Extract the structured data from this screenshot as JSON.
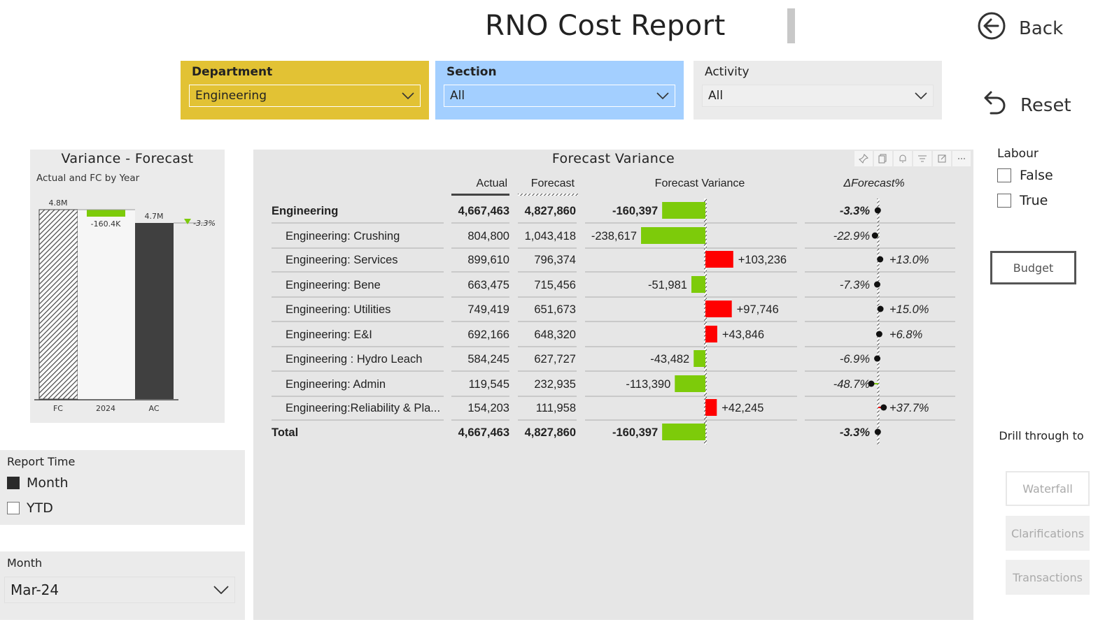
{
  "header": {
    "title": "RNO Cost Report",
    "back_label": "Back",
    "reset_label": "Reset"
  },
  "slicers": {
    "department": {
      "label": "Department",
      "value": "Engineering"
    },
    "section": {
      "label": "Section",
      "value": "All"
    },
    "activity": {
      "label": "Activity",
      "value": "All"
    }
  },
  "variance_chart": {
    "title": "Variance - Forecast",
    "subtitle": "Actual and FC by Year",
    "labels": {
      "fc": "4.8M",
      "delta": "-160.4K",
      "ac": "4.7M",
      "pct": "-3.3%"
    },
    "categories": [
      "FC",
      "2024",
      "AC"
    ]
  },
  "report_time": {
    "label": "Report Time",
    "options": [
      {
        "label": "Month",
        "checked": true
      },
      {
        "label": "YTD",
        "checked": false
      }
    ]
  },
  "month_slicer": {
    "label": "Month",
    "value": "Mar-24"
  },
  "table": {
    "title": "Forecast Variance",
    "columns": [
      "Actual",
      "Forecast",
      "Forecast Variance",
      "ΔForecast%"
    ],
    "rows": [
      {
        "name": "Engineering",
        "actual": "4,667,463",
        "forecast": "4,827,860",
        "variance": "-160,397",
        "pct": "-3.3%",
        "bold": true
      },
      {
        "name": "Engineering: Crushing",
        "actual": "804,800",
        "forecast": "1,043,418",
        "variance": "-238,617",
        "pct": "-22.9%"
      },
      {
        "name": "Engineering: Services",
        "actual": "899,610",
        "forecast": "796,374",
        "variance": "+103,236",
        "pct": "+13.0%"
      },
      {
        "name": "Engineering: Bene",
        "actual": "663,475",
        "forecast": "715,456",
        "variance": "-51,981",
        "pct": "-7.3%"
      },
      {
        "name": "Engineering: Utilities",
        "actual": "749,419",
        "forecast": "651,673",
        "variance": "+97,746",
        "pct": "+15.0%"
      },
      {
        "name": "Engineering: E&I",
        "actual": "692,166",
        "forecast": "648,320",
        "variance": "+43,846",
        "pct": "+6.8%"
      },
      {
        "name": "Engineering : Hydro Leach",
        "actual": "584,245",
        "forecast": "627,727",
        "variance": "-43,482",
        "pct": "-6.9%"
      },
      {
        "name": "Engineering: Admin",
        "actual": "119,545",
        "forecast": "232,935",
        "variance": "-113,390",
        "pct": "-48.7%"
      },
      {
        "name": "Engineering:Reliability & Pla...",
        "actual": "154,203",
        "forecast": "111,958",
        "variance": "+42,245",
        "pct": "+37.7%"
      },
      {
        "name": "Total",
        "actual": "4,667,463",
        "forecast": "4,827,860",
        "variance": "-160,397",
        "pct": "-3.3%",
        "bold": true
      }
    ]
  },
  "labour": {
    "label": "Labour",
    "options": [
      {
        "label": "False",
        "checked": false
      },
      {
        "label": "True",
        "checked": false
      }
    ]
  },
  "budget_label": "Budget",
  "drill": {
    "label": "Drill through to",
    "buttons": [
      "Waterfall",
      "Clarifications",
      "Transactions"
    ]
  },
  "colors": {
    "department": "#e2c234",
    "section": "#a3cfff",
    "positive": "#7dcb0a",
    "negative": "#ff0000"
  },
  "chart_data": [
    {
      "type": "bar",
      "title": "Variance - Forecast",
      "subtitle": "Actual and FC by Year",
      "categories": [
        "FC",
        "2024",
        "AC"
      ],
      "values": [
        4827860,
        -160397,
        4667463
      ],
      "data_labels": [
        "4.8M",
        "-160.4K",
        "4.7M"
      ],
      "annotation": "-3.3%",
      "ylim": [
        0,
        5000000
      ]
    },
    {
      "type": "bar",
      "title": "Forecast Variance",
      "categories": [
        "Engineering",
        "Engineering: Crushing",
        "Engineering: Services",
        "Engineering: Bene",
        "Engineering: Utilities",
        "Engineering: E&I",
        "Engineering : Hydro Leach",
        "Engineering: Admin",
        "Engineering:Reliability & Pla...",
        "Total"
      ],
      "series": [
        {
          "name": "Forecast Variance",
          "values": [
            -160397,
            -238617,
            103236,
            -51981,
            97746,
            43846,
            -43482,
            -113390,
            42245,
            -160397
          ]
        },
        {
          "name": "ΔForecast%",
          "values": [
            -3.3,
            -22.9,
            13.0,
            -7.3,
            15.0,
            6.8,
            -6.9,
            -48.7,
            37.7,
            -3.3
          ]
        }
      ]
    }
  ]
}
